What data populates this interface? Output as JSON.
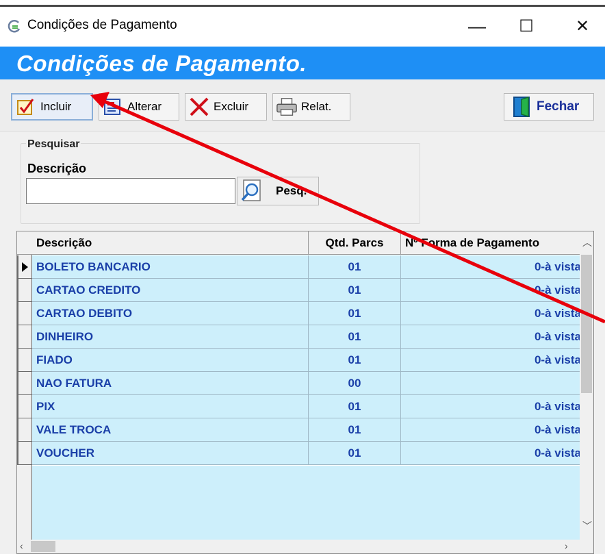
{
  "window": {
    "title": "Condições de Pagamento",
    "minimize_glyph": "—",
    "maximize_glyph": "☐",
    "close_glyph": "✕"
  },
  "header": {
    "title": "Condições de Pagamento."
  },
  "toolbar": {
    "incluir_label": "Incluir",
    "alterar_label": "Alterar",
    "excluir_label": "Excluir",
    "relat_label": "Relat.",
    "fechar_label": "Fechar"
  },
  "search": {
    "group_label": "Pesquisar",
    "field_label": "Descrição",
    "value": "",
    "button_label": "Pesq."
  },
  "grid": {
    "columns": [
      "Descrição",
      "Qtd. Parcs",
      "Nº Forma de Pagamento"
    ],
    "rows": [
      {
        "descricao": "BOLETO BANCARIO",
        "parcs": "01",
        "forma": "0-à vista",
        "selected": true
      },
      {
        "descricao": "CARTAO CREDITO",
        "parcs": "01",
        "forma": "0-à vista"
      },
      {
        "descricao": "CARTAO DEBITO",
        "parcs": "01",
        "forma": "0-à vista"
      },
      {
        "descricao": "DINHEIRO",
        "parcs": "01",
        "forma": "0-à vista"
      },
      {
        "descricao": "FIADO",
        "parcs": "01",
        "forma": "0-à vista"
      },
      {
        "descricao": "NAO FATURA",
        "parcs": "00",
        "forma": ""
      },
      {
        "descricao": "PIX",
        "parcs": "01",
        "forma": "0-à vista"
      },
      {
        "descricao": "VALE TROCA",
        "parcs": "01",
        "forma": "0-à vista"
      },
      {
        "descricao": "VOUCHER",
        "parcs": "01",
        "forma": "0-à vista"
      }
    ]
  },
  "colors": {
    "header_band": "#1e8ff5",
    "row_background": "#cdeffb",
    "row_text": "#1a3fa8",
    "annotation_arrow": "#e8000b"
  },
  "icons": [
    "app-logo-icon",
    "checkmark-doc-icon",
    "edit-doc-icon",
    "red-x-icon",
    "printer-icon",
    "magnifier-icon",
    "door-exit-icon"
  ]
}
